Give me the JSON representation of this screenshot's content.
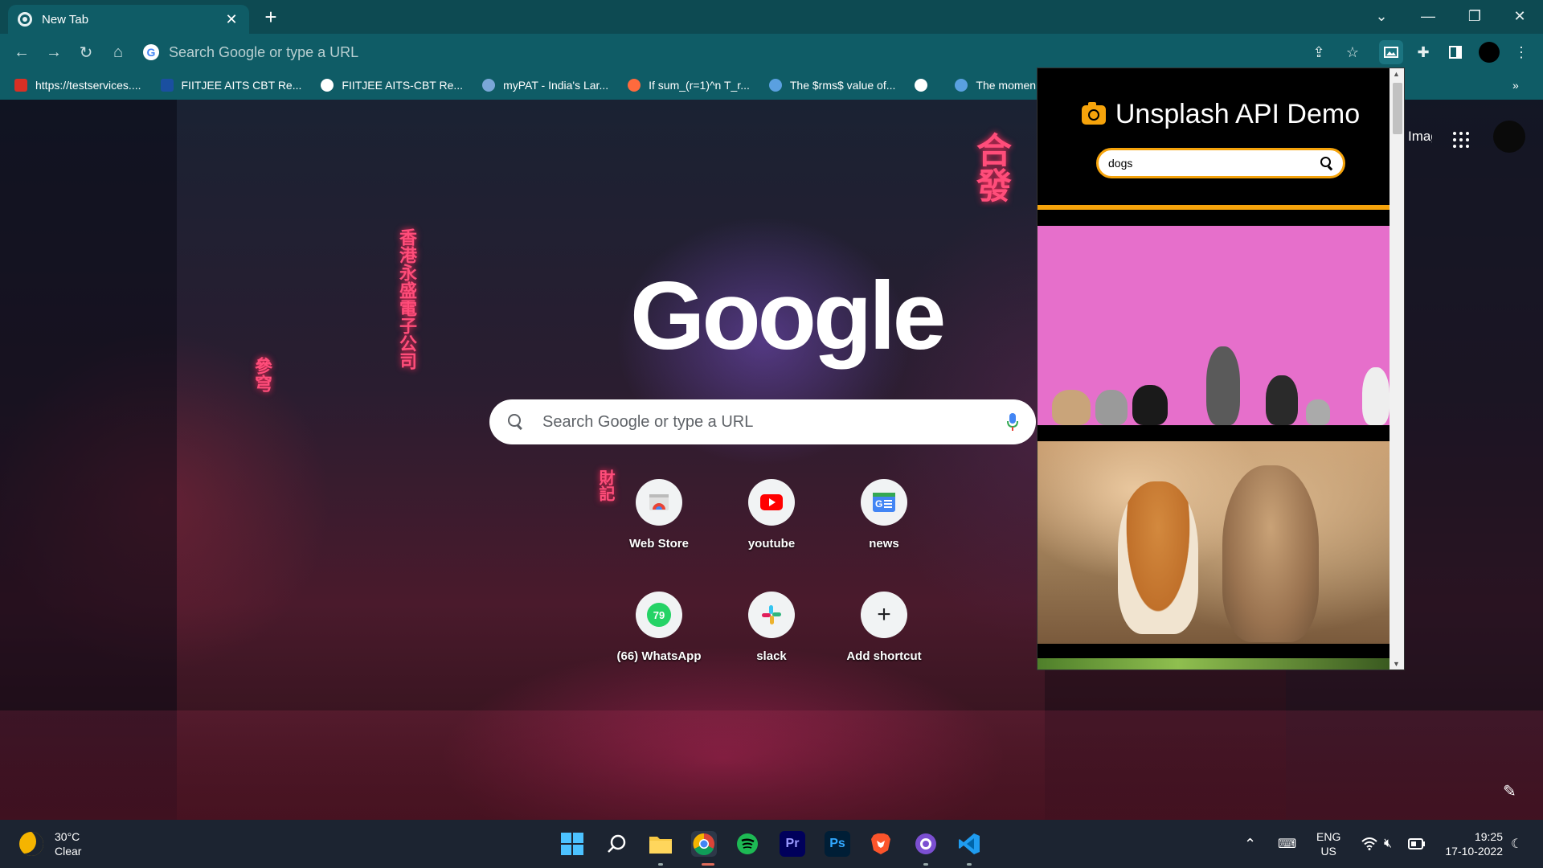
{
  "browser": {
    "tab_title": "New Tab",
    "omnibox_placeholder": "Search Google or type a URL",
    "bookmarks": [
      {
        "label": "https://testservices....",
        "color": "#d93025"
      },
      {
        "label": "FIITJEE AITS CBT Re...",
        "color": "#1a4fa0"
      },
      {
        "label": "FIITJEE AITS-CBT Re...",
        "color": "#ffffff"
      },
      {
        "label": "myPAT - India's Lar...",
        "color": "#7aa7d8"
      },
      {
        "label": "If sum_(r=1)^n T_r...",
        "color": "#ff6a3d"
      },
      {
        "label": "The $rms$ value of...",
        "color": "#5aa0e0"
      },
      {
        "label": "",
        "color": "#ffffff"
      },
      {
        "label": "The momen",
        "color": "#5aa0e0"
      }
    ],
    "more_bookmarks": "»"
  },
  "ntp": {
    "logo_text": "Google",
    "search_placeholder": "Search Google or type a URL",
    "images_link": "Images",
    "shortcuts": [
      {
        "label": "Web Store",
        "icon": "web-store-icon"
      },
      {
        "label": "youtube",
        "icon": "youtube-icon"
      },
      {
        "label": "news",
        "icon": "news-icon"
      },
      {
        "label": "(66) WhatsApp",
        "icon": "whatsapp-icon",
        "badge": "79"
      },
      {
        "label": "slack",
        "icon": "slack-icon"
      },
      {
        "label": "Add shortcut",
        "icon": "plus-icon"
      }
    ]
  },
  "extension": {
    "title": "Unsplash API Demo",
    "search_value": "dogs",
    "accent_color": "#f5a30b"
  },
  "taskbar": {
    "temperature": "30°C",
    "condition": "Clear",
    "lang_primary": "ENG",
    "lang_secondary": "US",
    "time": "19:25",
    "date": "17-10-2022"
  }
}
